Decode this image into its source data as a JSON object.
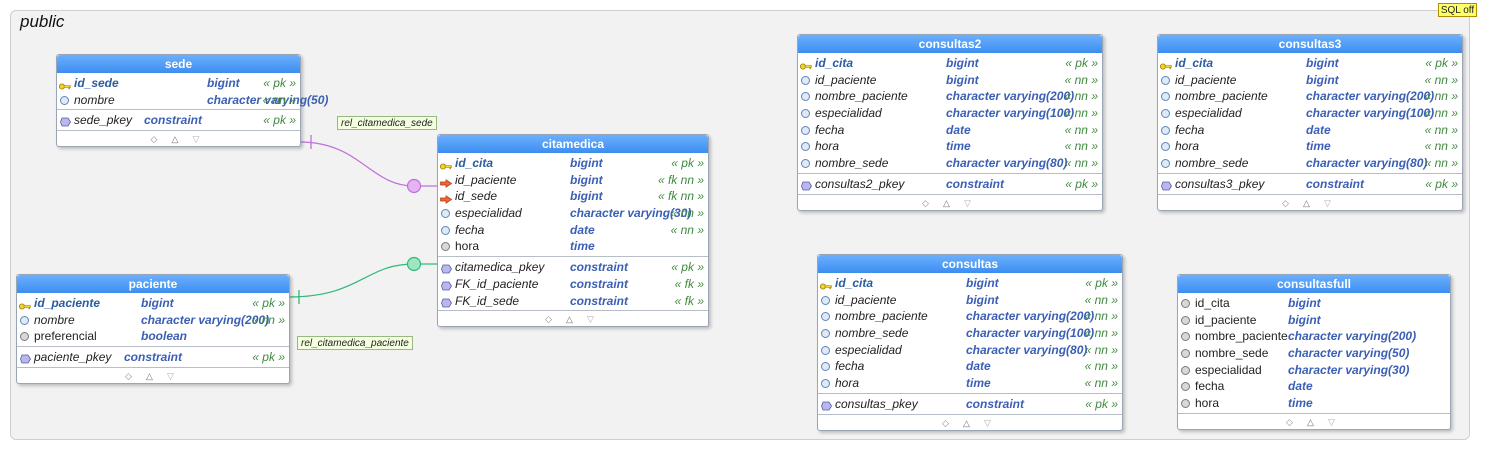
{
  "schema": {
    "name": "public",
    "sql_badge": "SQL off"
  },
  "relations": [
    {
      "label": "rel_citamedica_sede",
      "color": "#bf6fdc"
    },
    {
      "label": "rel_citamedica_paciente",
      "color": "#30b878"
    }
  ],
  "tables": {
    "sede": {
      "name": "sede",
      "columns": [
        {
          "name": "id_sede",
          "type": "bigint",
          "flags": "« pk »",
          "icon": "primary-key-icon"
        },
        {
          "name": "nombre",
          "type": "character varying(50)",
          "flags": "« nn »",
          "icon": "column-icon"
        }
      ],
      "constraints": [
        {
          "name": "sede_pkey",
          "type": "constraint",
          "flags": "« pk »"
        }
      ]
    },
    "paciente": {
      "name": "paciente",
      "columns": [
        {
          "name": "id_paciente",
          "type": "bigint",
          "flags": "« pk »",
          "icon": "primary-key-icon"
        },
        {
          "name": "nombre",
          "type": "character varying(200)",
          "flags": "« nn »",
          "icon": "column-icon"
        },
        {
          "name": "preferencial",
          "type": "boolean",
          "flags": "",
          "icon": "nullable-column-icon"
        }
      ],
      "constraints": [
        {
          "name": "paciente_pkey",
          "type": "constraint",
          "flags": "« pk »"
        }
      ]
    },
    "citamedica": {
      "name": "citamedica",
      "columns": [
        {
          "name": "id_cita",
          "type": "bigint",
          "flags": "« pk »",
          "icon": "primary-key-icon"
        },
        {
          "name": "id_paciente",
          "type": "bigint",
          "flags": "« fk nn »",
          "icon": "foreign-key-icon"
        },
        {
          "name": "id_sede",
          "type": "bigint",
          "flags": "« fk nn »",
          "icon": "foreign-key-icon"
        },
        {
          "name": "especialidad",
          "type": "character varying(30)",
          "flags": "« nn »",
          "icon": "column-icon"
        },
        {
          "name": "fecha",
          "type": "date",
          "flags": "« nn »",
          "icon": "column-icon"
        },
        {
          "name": "hora",
          "type": "time",
          "flags": "",
          "icon": "nullable-column-icon"
        }
      ],
      "constraints": [
        {
          "name": "citamedica_pkey",
          "type": "constraint",
          "flags": "« pk »"
        },
        {
          "name": "FK_id_paciente",
          "type": "constraint",
          "flags": "« fk »"
        },
        {
          "name": "FK_id_sede",
          "type": "constraint",
          "flags": "« fk »"
        }
      ]
    },
    "consultas2": {
      "name": "consultas2",
      "columns": [
        {
          "name": "id_cita",
          "type": "bigint",
          "flags": "« pk »",
          "icon": "primary-key-icon"
        },
        {
          "name": "id_paciente",
          "type": "bigint",
          "flags": "« nn »",
          "icon": "column-icon"
        },
        {
          "name": "nombre_paciente",
          "type": "character varying(200)",
          "flags": "« nn »",
          "icon": "column-icon"
        },
        {
          "name": "especialidad",
          "type": "character varying(100)",
          "flags": "« nn »",
          "icon": "column-icon"
        },
        {
          "name": "fecha",
          "type": "date",
          "flags": "« nn »",
          "icon": "column-icon"
        },
        {
          "name": "hora",
          "type": "time",
          "flags": "« nn »",
          "icon": "column-icon"
        },
        {
          "name": "nombre_sede",
          "type": "character varying(80)",
          "flags": "« nn »",
          "icon": "column-icon"
        }
      ],
      "constraints": [
        {
          "name": "consultas2_pkey",
          "type": "constraint",
          "flags": "« pk »"
        }
      ]
    },
    "consultas3": {
      "name": "consultas3",
      "columns": [
        {
          "name": "id_cita",
          "type": "bigint",
          "flags": "« pk »",
          "icon": "primary-key-icon"
        },
        {
          "name": "id_paciente",
          "type": "bigint",
          "flags": "« nn »",
          "icon": "column-icon"
        },
        {
          "name": "nombre_paciente",
          "type": "character varying(200)",
          "flags": "« nn »",
          "icon": "column-icon"
        },
        {
          "name": "especialidad",
          "type": "character varying(100)",
          "flags": "« nn »",
          "icon": "column-icon"
        },
        {
          "name": "fecha",
          "type": "date",
          "flags": "« nn »",
          "icon": "column-icon"
        },
        {
          "name": "hora",
          "type": "time",
          "flags": "« nn »",
          "icon": "column-icon"
        },
        {
          "name": "nombre_sede",
          "type": "character varying(80)",
          "flags": "« nn »",
          "icon": "column-icon"
        }
      ],
      "constraints": [
        {
          "name": "consultas3_pkey",
          "type": "constraint",
          "flags": "« pk »"
        }
      ]
    },
    "consultas": {
      "name": "consultas",
      "columns": [
        {
          "name": "id_cita",
          "type": "bigint",
          "flags": "« pk »",
          "icon": "primary-key-icon"
        },
        {
          "name": "id_paciente",
          "type": "bigint",
          "flags": "« nn »",
          "icon": "column-icon"
        },
        {
          "name": "nombre_paciente",
          "type": "character varying(200)",
          "flags": "« nn »",
          "icon": "column-icon"
        },
        {
          "name": "nombre_sede",
          "type": "character varying(100)",
          "flags": "« nn »",
          "icon": "column-icon"
        },
        {
          "name": "especialidad",
          "type": "character varying(80)",
          "flags": "« nn »",
          "icon": "column-icon"
        },
        {
          "name": "fecha",
          "type": "date",
          "flags": "« nn »",
          "icon": "column-icon"
        },
        {
          "name": "hora",
          "type": "time",
          "flags": "« nn »",
          "icon": "column-icon"
        }
      ],
      "constraints": [
        {
          "name": "consultas_pkey",
          "type": "constraint",
          "flags": "« pk »"
        }
      ]
    },
    "consultasfull": {
      "name": "consultasfull",
      "columns": [
        {
          "name": "id_cita",
          "type": "bigint",
          "flags": "",
          "icon": "nullable-column-icon"
        },
        {
          "name": "id_paciente",
          "type": "bigint",
          "flags": "",
          "icon": "nullable-column-icon"
        },
        {
          "name": "nombre_paciente",
          "type": "character varying(200)",
          "flags": "",
          "icon": "nullable-column-icon"
        },
        {
          "name": "nombre_sede",
          "type": "character varying(50)",
          "flags": "",
          "icon": "nullable-column-icon"
        },
        {
          "name": "especialidad",
          "type": "character varying(30)",
          "flags": "",
          "icon": "nullable-column-icon"
        },
        {
          "name": "fecha",
          "type": "date",
          "flags": "",
          "icon": "nullable-column-icon"
        },
        {
          "name": "hora",
          "type": "time",
          "flags": "",
          "icon": "nullable-column-icon"
        }
      ],
      "constraints": []
    }
  },
  "footer_icons": [
    "diamond-icon",
    "triangle-up-icon",
    "triangle-down-icon"
  ]
}
